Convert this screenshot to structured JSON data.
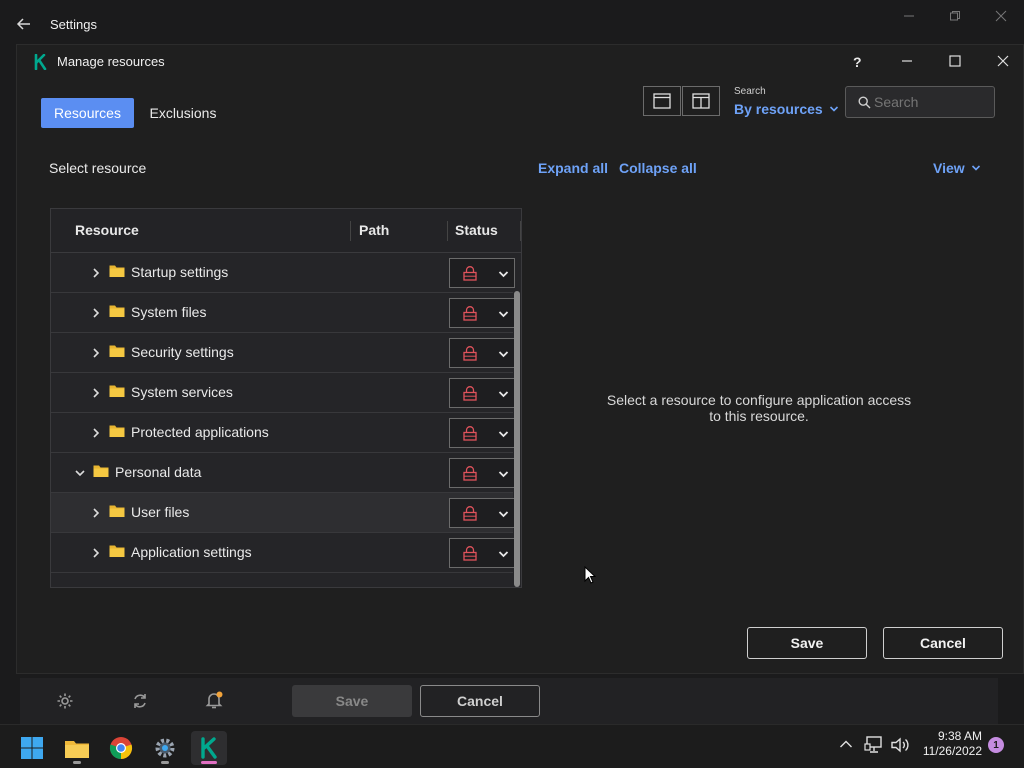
{
  "settings_window": {
    "title": "Settings"
  },
  "dialog": {
    "title": "Manage resources",
    "help_label": "?",
    "tabs": [
      {
        "label": "Resources",
        "active": true
      },
      {
        "label": "Exclusions",
        "active": false
      }
    ],
    "search": {
      "caption": "Search",
      "mode": "By resources",
      "placeholder": "Search"
    },
    "select_resource_label": "Select resource",
    "expand_all": "Expand all",
    "collapse_all": "Collapse all",
    "view_label": "View",
    "table": {
      "columns": [
        "Resource",
        "Path",
        "Status"
      ],
      "rows": [
        {
          "label": "Startup settings",
          "level": 2,
          "expanded": false,
          "status": "locked"
        },
        {
          "label": "System files",
          "level": 2,
          "expanded": false,
          "status": "locked"
        },
        {
          "label": "Security settings",
          "level": 2,
          "expanded": false,
          "status": "locked"
        },
        {
          "label": "System services",
          "level": 2,
          "expanded": false,
          "status": "locked"
        },
        {
          "label": "Protected applications",
          "level": 2,
          "expanded": false,
          "status": "locked"
        },
        {
          "label": "Personal data",
          "level": 1,
          "expanded": true,
          "status": "locked"
        },
        {
          "label": "User files",
          "level": 2,
          "expanded": false,
          "status": "locked"
        },
        {
          "label": "Application settings",
          "level": 2,
          "expanded": false,
          "status": "locked"
        }
      ]
    },
    "placeholder_message_line1": "Select a resource to configure application access",
    "placeholder_message_line2": "to this resource.",
    "save_label": "Save",
    "cancel_label": "Cancel"
  },
  "settings_footer": {
    "save_label": "Save",
    "cancel_label": "Cancel"
  },
  "taskbar": {
    "time": "9:38 AM",
    "date": "11/26/2022",
    "notification_count": "1"
  },
  "colors": {
    "accent": "#5b8ef2",
    "link": "#6ea2f7",
    "lock_red": "#e0535c",
    "folder_yellow": "#f5c842",
    "kaspersky_green": "#00a88e"
  }
}
